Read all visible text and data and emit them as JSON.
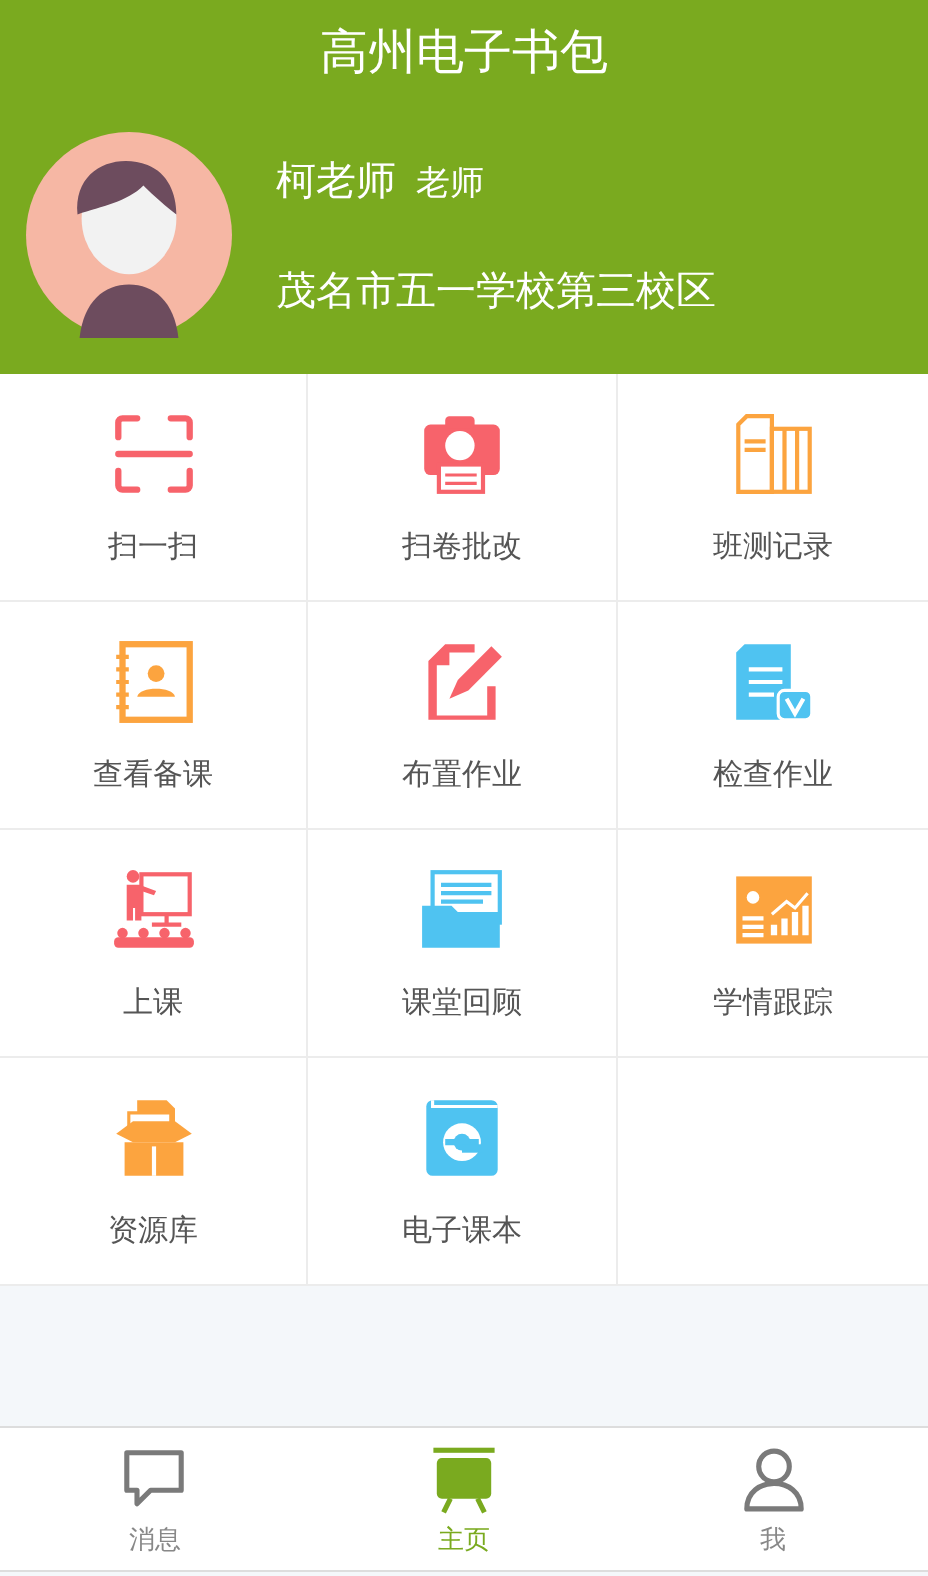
{
  "header": {
    "title": "高州电子书包"
  },
  "profile": {
    "name": "柯老师",
    "role": "老师",
    "school": "茂名市五一学校第三校区"
  },
  "tiles": [
    {
      "label": "扫一扫",
      "kind": "scan"
    },
    {
      "label": "扫卷批改",
      "kind": "camera"
    },
    {
      "label": "班测记录",
      "kind": "record"
    },
    {
      "label": "查看备课",
      "kind": "notebook"
    },
    {
      "label": "布置作业",
      "kind": "edit"
    },
    {
      "label": "检查作业",
      "kind": "check"
    },
    {
      "label": "上课",
      "kind": "teach"
    },
    {
      "label": "课堂回顾",
      "kind": "folder"
    },
    {
      "label": "学情跟踪",
      "kind": "chart"
    },
    {
      "label": "资源库",
      "kind": "box"
    },
    {
      "label": "电子课本",
      "kind": "ebook"
    }
  ],
  "tab_bar": [
    {
      "label": "消息",
      "kind": "message",
      "selected": false
    },
    {
      "label": "主页",
      "kind": "home",
      "selected": true
    },
    {
      "label": "我",
      "kind": "person",
      "selected": false
    }
  ]
}
